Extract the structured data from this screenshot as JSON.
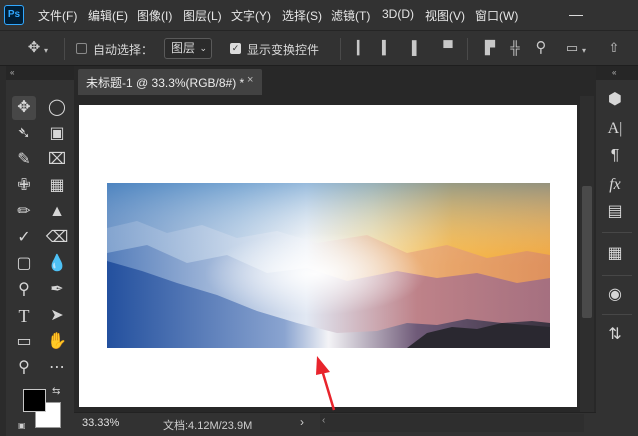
{
  "app": {
    "logo": "Ps"
  },
  "menu": {
    "items": [
      "文件(F)",
      "编辑(E)",
      "图像(I)",
      "图层(L)",
      "文字(Y)",
      "选择(S)",
      "滤镜(T)",
      "3D(D)",
      "视图(V)",
      "窗口(W)"
    ]
  },
  "options": {
    "auto_select_label": "自动选择：",
    "auto_select_checked": false,
    "layer_dropdown_value": "图层",
    "show_transform_label": "显示变换控件",
    "show_transform_checked": true
  },
  "document": {
    "tab_title": "未标题-1 @ 33.3%(RGB/8#) *",
    "close_glyph": "×"
  },
  "status": {
    "zoom": "33.33%",
    "doc_info": "文档:4.12M/23.9M",
    "arrow": "›",
    "scroll_left": "‹"
  },
  "panel": {
    "collapse_left": "«",
    "collapse_right": "«"
  },
  "icons": {
    "tools": [
      "move-tool-icon",
      "marquee-tool-icon",
      "lasso-tool-icon",
      "object-select-tool-icon",
      "eyedropper-tool-icon",
      "frame-tool-icon",
      "spot-heal-tool-icon",
      "crop-tool-icon",
      "brush-tool-icon",
      "stamp-tool-icon",
      "history-brush-tool-icon",
      "eraser-tool-icon",
      "gradient-tool-icon",
      "blur-tool-icon",
      "dodge-tool-icon",
      "pen-tool-icon",
      "type-tool-icon",
      "path-select-tool-icon",
      "rectangle-tool-icon",
      "hand-tool-icon",
      "zoom-tool-icon",
      "more-tools-icon"
    ],
    "right": [
      "3d-icon",
      "character-icon",
      "paragraph-icon",
      "fx-icon",
      "swatches-icon",
      "properties-icon",
      "brush-presets-icon"
    ]
  },
  "colors": {
    "accent_ps": "#31a8ff",
    "annotation_arrow": "#e8242c",
    "foreground": "#000000",
    "background": "#ffffff"
  }
}
